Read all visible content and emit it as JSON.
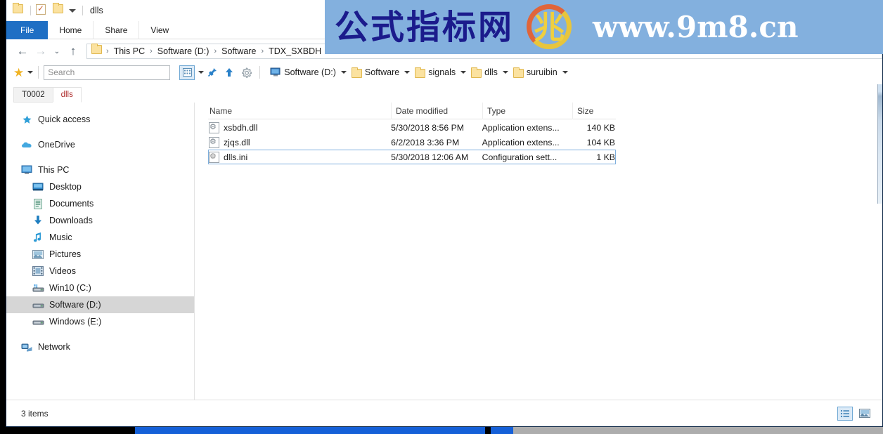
{
  "window": {
    "title": "dlls",
    "quick_access": [
      {
        "name": "folder-icon",
        "label": "Folder"
      },
      {
        "name": "properties-icon",
        "label": "Properties"
      },
      {
        "name": "new-folder-icon",
        "label": "New folder"
      }
    ]
  },
  "ribbon": {
    "tabs": [
      {
        "label": "File",
        "active": true
      },
      {
        "label": "Home",
        "active": false
      },
      {
        "label": "Share",
        "active": false
      },
      {
        "label": "View",
        "active": false
      }
    ]
  },
  "nav": {
    "back_icon": "←",
    "forward_icon": "→",
    "history_icon": "⌄",
    "up_icon": "↑",
    "breadcrumb": [
      "This PC",
      "Software (D:)",
      "Software",
      "TDX_SXBDH"
    ],
    "separator": "›"
  },
  "toolbar": {
    "favorites_icon": "★",
    "search": {
      "placeholder": "Search",
      "value": ""
    },
    "view_icon": "▦",
    "pin_icon": "📌",
    "up_icon": "⬆",
    "settings_icon": "⚙",
    "drives": [
      {
        "label": "Software (D:)",
        "icon": "computer-icon"
      },
      {
        "label": "Software",
        "icon": "folder-icon"
      },
      {
        "label": "signals",
        "icon": "folder-icon"
      },
      {
        "label": "dlls",
        "icon": "folder-icon"
      },
      {
        "label": "suruibin",
        "icon": "folder-icon"
      }
    ]
  },
  "tabs": [
    {
      "label": "T0002",
      "active": false
    },
    {
      "label": "dlls",
      "active": true
    }
  ],
  "sidebar": {
    "items": [
      {
        "label": "Quick access",
        "icon": "star-icon",
        "indent": false,
        "selected": false
      },
      {
        "label": "OneDrive",
        "icon": "cloud-icon",
        "indent": false,
        "selected": false
      },
      {
        "label": "This PC",
        "icon": "monitor-icon",
        "indent": false,
        "selected": false
      },
      {
        "label": "Desktop",
        "icon": "desktop-icon",
        "indent": true,
        "selected": false
      },
      {
        "label": "Documents",
        "icon": "documents-icon",
        "indent": true,
        "selected": false
      },
      {
        "label": "Downloads",
        "icon": "download-icon",
        "indent": true,
        "selected": false
      },
      {
        "label": "Music",
        "icon": "music-icon",
        "indent": true,
        "selected": false
      },
      {
        "label": "Pictures",
        "icon": "pictures-icon",
        "indent": true,
        "selected": false
      },
      {
        "label": "Videos",
        "icon": "videos-icon",
        "indent": true,
        "selected": false
      },
      {
        "label": "Win10 (C:)",
        "icon": "drive-icon",
        "indent": true,
        "selected": false
      },
      {
        "label": "Software (D:)",
        "icon": "drive-icon",
        "indent": true,
        "selected": true
      },
      {
        "label": "Windows (E:)",
        "icon": "drive-icon",
        "indent": true,
        "selected": false
      },
      {
        "label": "Network",
        "icon": "network-icon",
        "indent": false,
        "selected": false
      }
    ]
  },
  "filelist": {
    "columns": [
      "Name",
      "Date modified",
      "Type",
      "Size"
    ],
    "sort_indicator": "⌃",
    "sort_column": "Type",
    "rows": [
      {
        "name": "xsbdh.dll",
        "date": "5/30/2018 8:56 PM",
        "type": "Application extens...",
        "size": "140 KB",
        "icon": "dll-icon",
        "focused": false
      },
      {
        "name": "zjqs.dll",
        "date": "6/2/2018 3:36 PM",
        "type": "Application extens...",
        "size": "104 KB",
        "icon": "dll-icon",
        "focused": false
      },
      {
        "name": "dlls.ini",
        "date": "5/30/2018 12:06 AM",
        "type": "Configuration sett...",
        "size": "1 KB",
        "icon": "ini-icon",
        "focused": true
      }
    ]
  },
  "statusbar": {
    "item_count": "3 items",
    "views": [
      {
        "name": "details-view-button",
        "icon": "▤",
        "active": true
      },
      {
        "name": "large-icons-view-button",
        "icon": "🖼",
        "active": false
      }
    ]
  },
  "watermark": {
    "chinese_text": "公式指标网",
    "logo_glyph": "兆",
    "logo_caption": "www.9m8.cn",
    "url_text": "www.9m8.cn",
    "band_color": "#83b0de",
    "text_color": "#1b1b8c"
  }
}
